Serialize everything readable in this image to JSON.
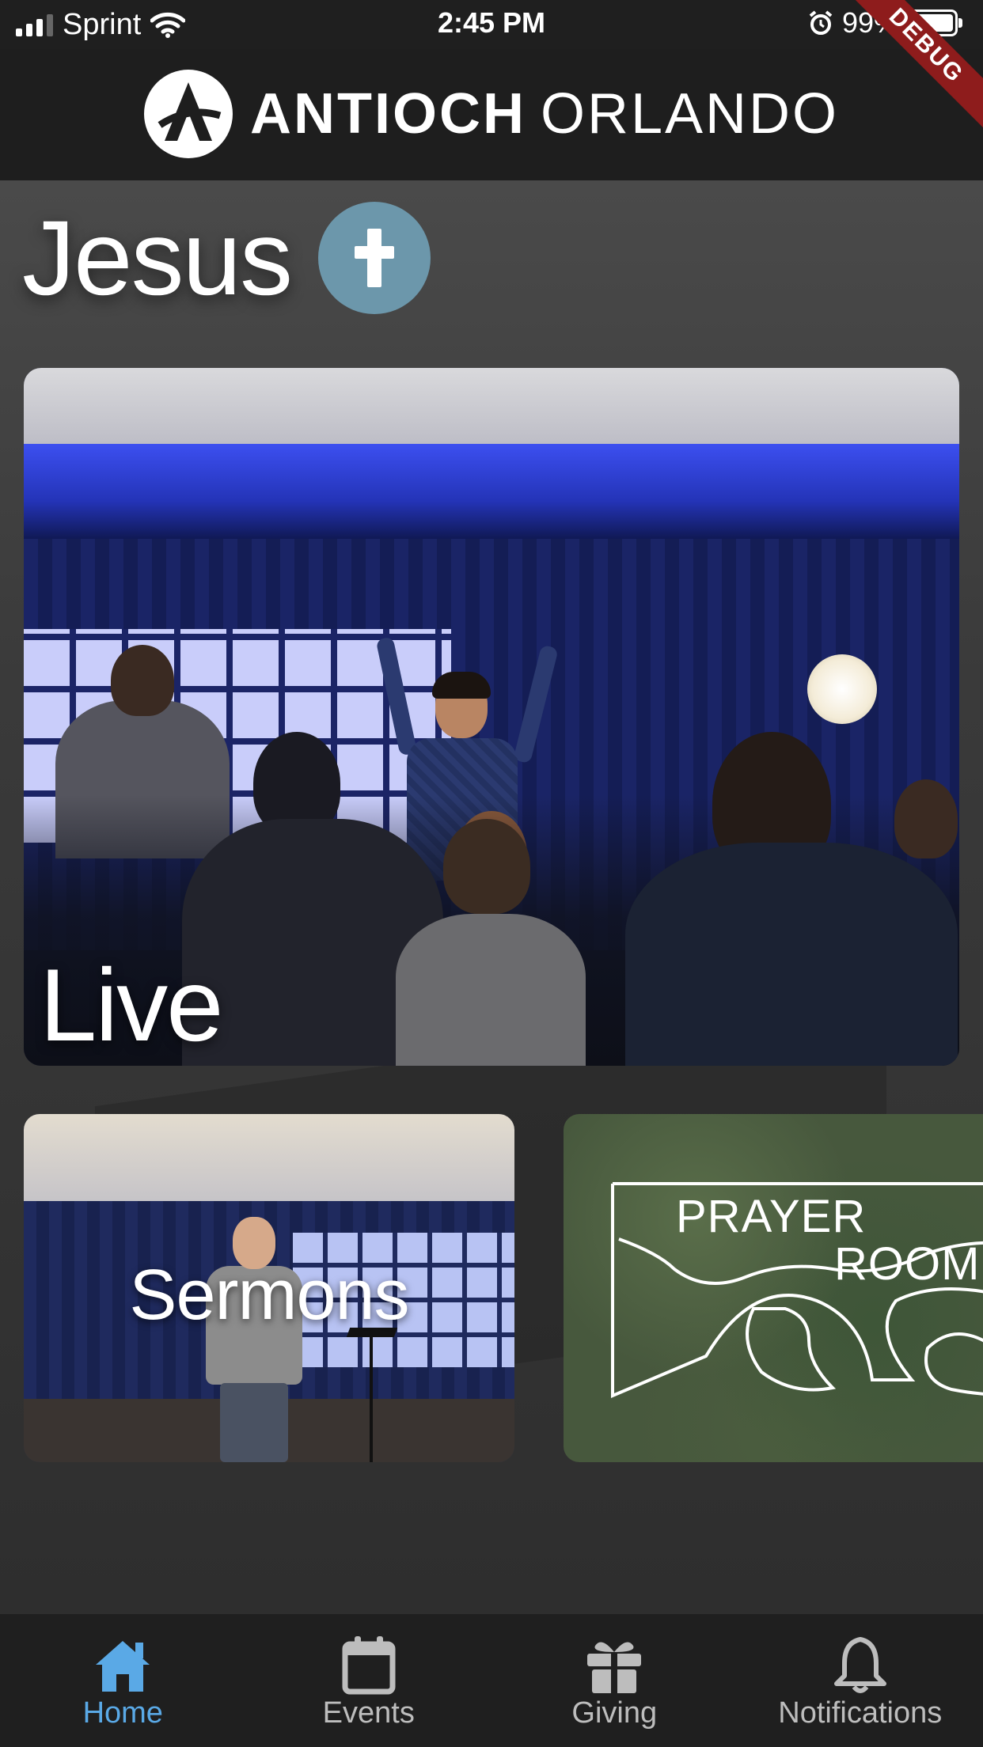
{
  "status_bar": {
    "carrier": "Sprint",
    "time": "2:45 PM",
    "battery": "99%",
    "debug_banner": "DEBUG"
  },
  "header": {
    "logo_bold": "ANTIOCH",
    "logo_light": "ORLANDO"
  },
  "main": {
    "title": "Jesus",
    "cards": {
      "live": {
        "label": "Live"
      },
      "sermons": {
        "label": "Sermons"
      },
      "prayer_room": {
        "line1": "PRAYER",
        "line2": "ROOM"
      }
    }
  },
  "tabs": [
    {
      "label": "Home",
      "icon": "home-icon",
      "active": true
    },
    {
      "label": "Events",
      "icon": "calendar-icon",
      "active": false
    },
    {
      "label": "Giving",
      "icon": "gift-icon",
      "active": false
    },
    {
      "label": "Notifications",
      "icon": "bell-icon",
      "active": false
    }
  ],
  "colors": {
    "accent": "#5aa9e6",
    "cross_badge": "#6c97ab",
    "debug_banner": "#8e1c1c"
  }
}
